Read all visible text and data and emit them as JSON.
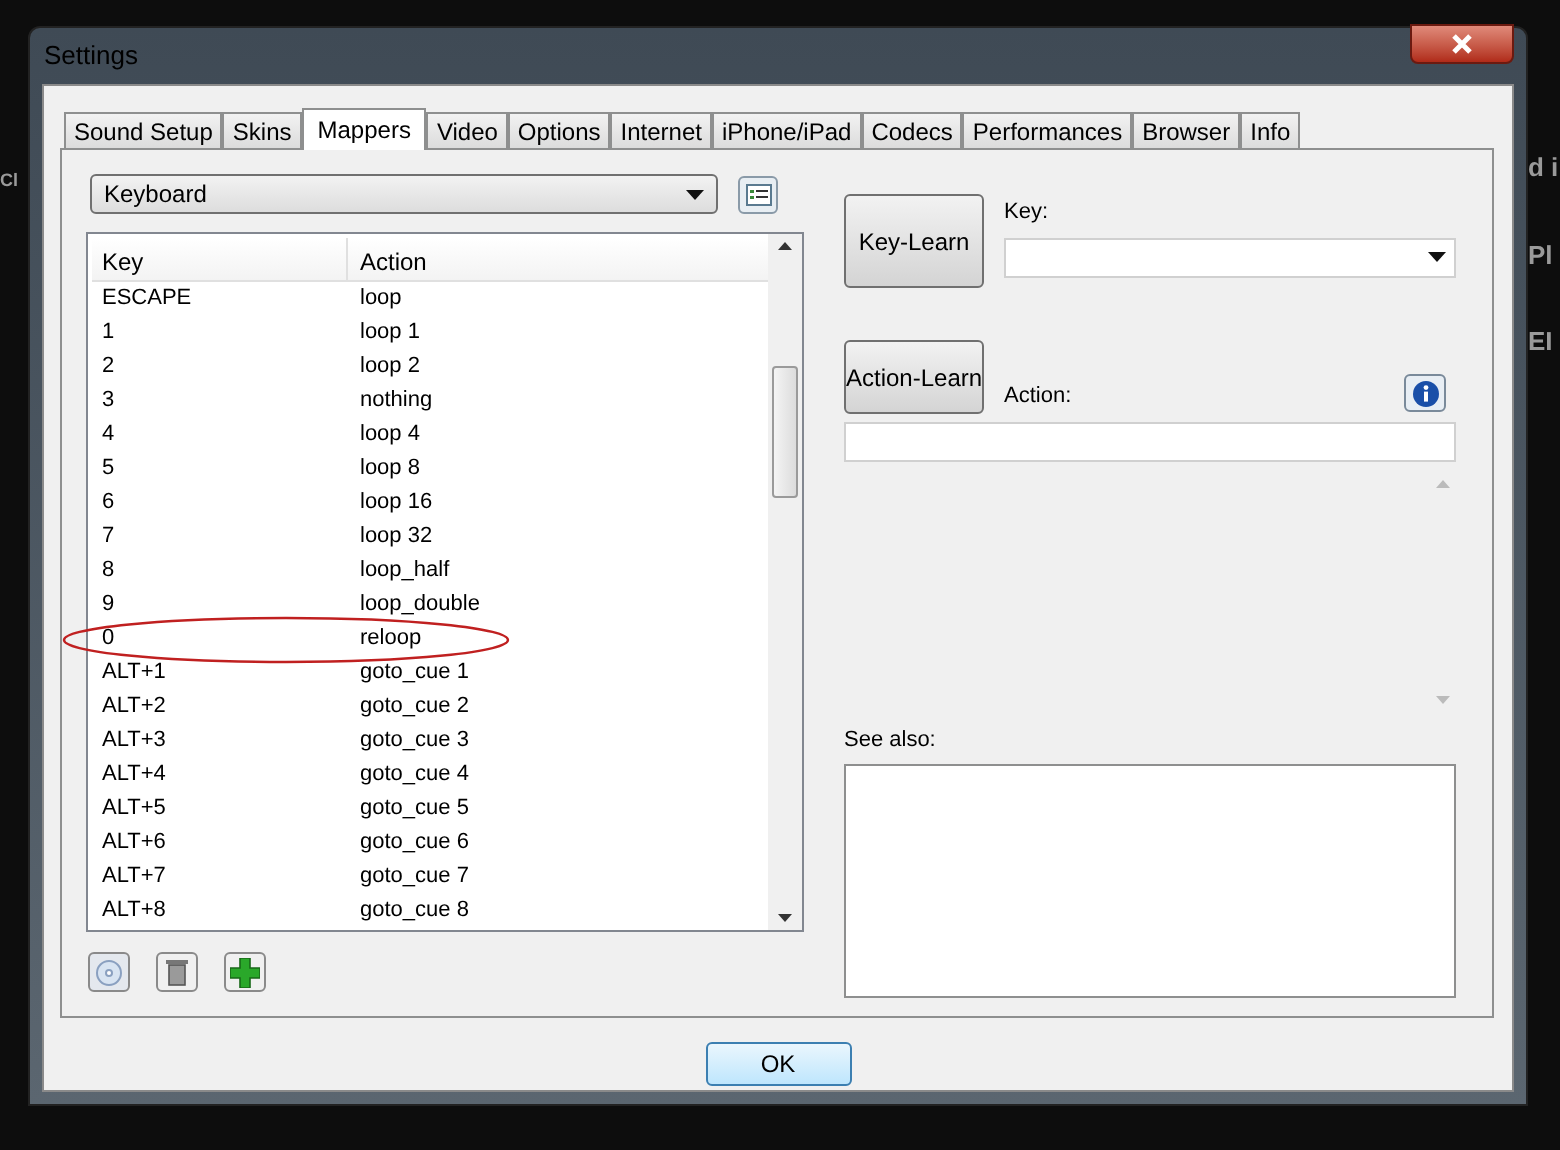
{
  "window": {
    "title": "Settings"
  },
  "background_left": [
    "Cl"
  ],
  "background_right": [
    "d i",
    "Pl",
    "EI"
  ],
  "tabs": [
    {
      "label": "Sound Setup",
      "selected": false
    },
    {
      "label": "Skins",
      "selected": false
    },
    {
      "label": "Mappers",
      "selected": true
    },
    {
      "label": "Video",
      "selected": false
    },
    {
      "label": "Options",
      "selected": false
    },
    {
      "label": "Internet",
      "selected": false
    },
    {
      "label": "iPhone/iPad",
      "selected": false
    },
    {
      "label": "Codecs",
      "selected": false
    },
    {
      "label": "Performances",
      "selected": false
    },
    {
      "label": "Browser",
      "selected": false
    },
    {
      "label": "Info",
      "selected": false
    }
  ],
  "mapper_select": {
    "value": "Keyboard"
  },
  "table": {
    "columns": [
      "Key",
      "Action"
    ],
    "rows": [
      {
        "key": "ESCAPE",
        "action": "loop",
        "circled": false
      },
      {
        "key": "1",
        "action": "loop 1",
        "circled": false
      },
      {
        "key": "2",
        "action": "loop 2",
        "circled": false
      },
      {
        "key": "3",
        "action": "nothing",
        "circled": false
      },
      {
        "key": "4",
        "action": "loop 4",
        "circled": false
      },
      {
        "key": "5",
        "action": "loop 8",
        "circled": false
      },
      {
        "key": "6",
        "action": "loop 16",
        "circled": false
      },
      {
        "key": "7",
        "action": "loop 32",
        "circled": false
      },
      {
        "key": "8",
        "action": "loop_half",
        "circled": false
      },
      {
        "key": "9",
        "action": "loop_double",
        "circled": false
      },
      {
        "key": "0",
        "action": "reloop",
        "circled": true
      },
      {
        "key": "ALT+1",
        "action": "goto_cue 1",
        "circled": false
      },
      {
        "key": "ALT+2",
        "action": "goto_cue 2",
        "circled": false
      },
      {
        "key": "ALT+3",
        "action": "goto_cue 3",
        "circled": false
      },
      {
        "key": "ALT+4",
        "action": "goto_cue 4",
        "circled": false
      },
      {
        "key": "ALT+5",
        "action": "goto_cue 5",
        "circled": false
      },
      {
        "key": "ALT+6",
        "action": "goto_cue 6",
        "circled": false
      },
      {
        "key": "ALT+7",
        "action": "goto_cue 7",
        "circled": false
      },
      {
        "key": "ALT+8",
        "action": "goto_cue 8",
        "circled": false
      }
    ]
  },
  "key_learn_button": "Key-Learn",
  "key_label": "Key:",
  "action_learn_button": "Action-Learn",
  "action_label": "Action:",
  "see_also_label": "See also:",
  "ok_button": "OK"
}
